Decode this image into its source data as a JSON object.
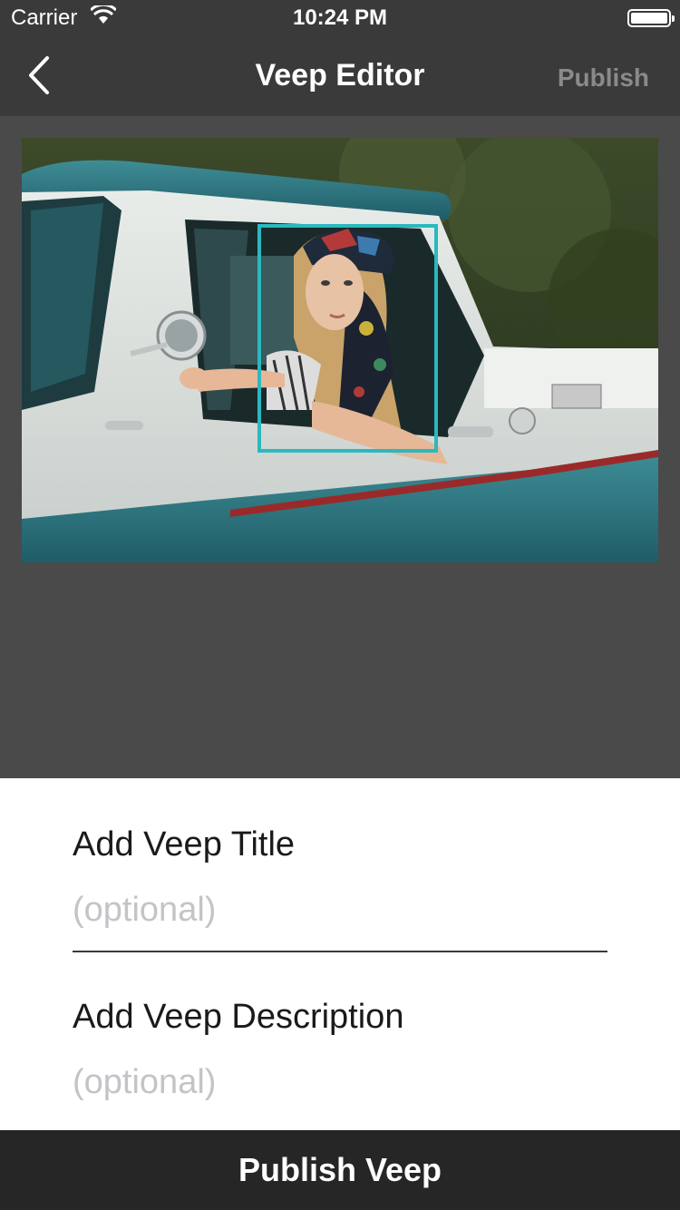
{
  "status_bar": {
    "carrier": "Carrier",
    "time": "10:24 PM"
  },
  "nav": {
    "title": "Veep Editor",
    "publish_label": "Publish"
  },
  "form": {
    "title_label": "Add Veep Title",
    "title_placeholder": "(optional)",
    "description_label": "Add Veep Description",
    "description_placeholder": "(optional)"
  },
  "footer": {
    "publish_veep_label": "Publish Veep"
  },
  "colors": {
    "nav_background": "#3a3a3a",
    "canvas_background": "#4a4a4a",
    "selection_box": "#2bb8bf",
    "disabled_text": "#8a8a8a",
    "footer_background": "#262626"
  },
  "icons": {
    "back": "chevron-left-icon",
    "wifi": "wifi-icon",
    "battery": "battery-icon"
  }
}
